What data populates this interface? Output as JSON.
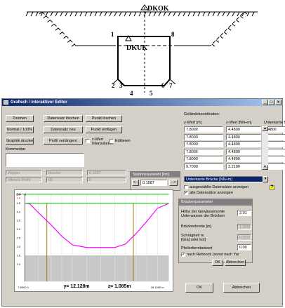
{
  "diagram": {
    "top_label": "DKOK",
    "mid_label": "DKUK",
    "points": [
      "1",
      "2",
      "3",
      "4",
      "5",
      "6",
      "7",
      "8"
    ]
  },
  "window": {
    "title": "Grafisch / interaktiver Editor",
    "buttons": {
      "zoomen": "Zoomen",
      "normal": "Normal / 100%",
      "graphik": "Graphik drucken",
      "dat_loeschen": "Datensatz löschen",
      "dat_neu": "Datensatz neu",
      "profil": "Profil verlängern",
      "punkt_loeschen": "Punkt löschen",
      "punkt_einfuegen": "Punkt einfügen",
      "ok_main": "OK",
      "abbrechen_main": "Abbrechen",
      "ok_small": "OK",
      "abbrechen_small": "Abbrechen"
    },
    "checks": {
      "zwert": "z-Wert Interpolieren",
      "editieren": "Editieren"
    },
    "kommentar_label": "Kommentar",
    "disabled_fields": {
      "r1": [
        "Wipper",
        "Brücke",
        "0.1587"
      ],
      "r2": [
        "offenes Profil",
        "00",
        "0"
      ]
    },
    "coords": {
      "heading": "Geländekoordinaten:",
      "headers": [
        "y-Wert [m]",
        "z-Wert [NN+m]",
        "Unterkante Brücke [NN+m]"
      ],
      "rows": [
        [
          "7.8000",
          "4.4800",
          "4.4800"
        ],
        [
          "7.8000",
          "4.4800",
          ""
        ],
        [
          "7.8000",
          "4.4800",
          ""
        ],
        [
          "7.8000",
          "4.4800",
          ""
        ],
        [
          "7.8000",
          "4.4800",
          ""
        ],
        [
          "9.7000",
          "3.2100",
          ""
        ]
      ]
    },
    "station": {
      "label": "Stationsauswahl [km]",
      "value": "0.1587",
      "prev": "<--",
      "next": "-->"
    },
    "dropdown": {
      "selected": "Unterkante Brücke [NN+m]"
    },
    "options": {
      "ausgewaehlt": "ausgewählte Datensätze anzeigen",
      "alle": "alle Datensätze anzeigen"
    },
    "bridge": {
      "title": "Brückenparameter",
      "hoehe_label": "Höhe der Gewässersohle\nUnterwasser der Brücken",
      "hoehe_value": "2.01",
      "breite_label": "Brückenbreite [m]",
      "breite_value": "1.0000",
      "schraeg_label": "Schrägheit m\n[Gra] oder kot]",
      "schraeg_value": "0.0000",
      "pfeiler_label": "Pfeilerformbeiwert",
      "pfeiler_value": "0.00",
      "rehbock": "nach Rehbock (sonst nach Yar"
    },
    "chart_status": {
      "y": "y= 12.128m",
      "z": "z= 1.085m"
    }
  },
  "chart_data": {
    "type": "line",
    "title": "",
    "xlabel": "",
    "ylabel": "",
    "y_unit": "[NN+m]",
    "ylim": [
      0.0,
      5.0
    ],
    "y_ticks": [
      "5.0",
      "4.8",
      "4.5",
      "4.0",
      "3.5",
      "3.0",
      "2.5",
      "2.0",
      "1.5",
      "1.0"
    ],
    "x_ticks": [
      "7.8000 h",
      "28.1000 m"
    ],
    "xlim": [
      7.8,
      28.1
    ],
    "series": [
      {
        "x": [
          7.8,
          8.5,
          9.7,
          11.5,
          13.0,
          14.5,
          16.5,
          18.5,
          20.5,
          22.0,
          23.5,
          25.0,
          26.5,
          28.1
        ],
        "y": [
          4.48,
          4.45,
          3.95,
          3.25,
          2.6,
          2.1,
          1.95,
          1.95,
          1.95,
          2.15,
          2.75,
          3.45,
          4.2,
          4.48
        ],
        "color": "#ff00ff"
      },
      {
        "x": [
          7.8,
          28.1
        ],
        "y": [
          5.0,
          5.0
        ],
        "color": "#00c000"
      },
      {
        "x": [
          7.8,
          28.1
        ],
        "y": [
          4.48,
          4.48
        ],
        "color": "#00c000"
      }
    ],
    "vlines": [
      {
        "x": 10.9,
        "color": "#a08000"
      },
      {
        "x": 23.1,
        "color": "#a08000"
      }
    ],
    "ground_level": 1.5
  }
}
